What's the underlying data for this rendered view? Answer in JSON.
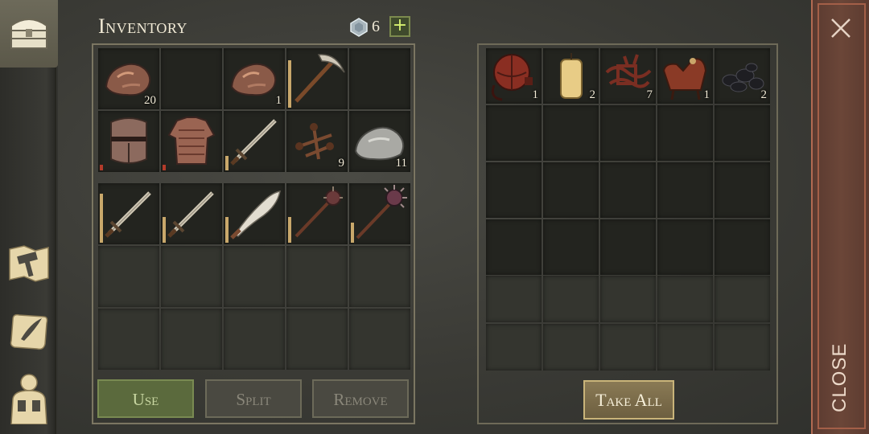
{
  "sidebar": {
    "items": [
      {
        "icon": "chest-icon",
        "active": true
      },
      {
        "icon": "hammer-map-icon"
      },
      {
        "icon": "scroll-quill-icon"
      },
      {
        "icon": "character-backpack-icon"
      }
    ]
  },
  "inventory": {
    "title": "Inventory",
    "gem_count": "6",
    "plus_label": "+",
    "slots": [
      {
        "icon": "copper-ore-icon",
        "count": "20"
      },
      {
        "icon": "empty"
      },
      {
        "icon": "copper-ore-icon",
        "count": "1"
      },
      {
        "icon": "pickaxe-icon",
        "durability": 0.82
      },
      {
        "icon": "empty"
      },
      {
        "icon": "great-helm-icon",
        "durability": 0.1,
        "low": true
      },
      {
        "icon": "chainmail-icon",
        "durability": 0.1,
        "low": true
      },
      {
        "icon": "sword-icon",
        "durability": 0.25
      },
      {
        "icon": "nails-icon",
        "count": "9"
      },
      {
        "icon": "stone-icon",
        "count": "11"
      }
    ],
    "weapon_slots": [
      {
        "icon": "sword-icon",
        "durability": 0.85
      },
      {
        "icon": "sword-icon",
        "durability": 0.45
      },
      {
        "icon": "scimitar-icon",
        "durability": 0.45
      },
      {
        "icon": "mace-icon",
        "durability": 0.45
      },
      {
        "icon": "morningstar-icon",
        "durability": 0.35
      }
    ],
    "buttons": {
      "use": "Use",
      "split": "Split",
      "remove": "Remove"
    }
  },
  "container": {
    "slots": [
      {
        "icon": "leather-flask-icon",
        "count": "1"
      },
      {
        "icon": "candle-icon",
        "count": "2"
      },
      {
        "icon": "leather-straps-icon",
        "count": "7"
      },
      {
        "icon": "saddle-icon",
        "count": "1"
      },
      {
        "icon": "coal-icon",
        "count": "2"
      }
    ],
    "take_all_label": "Take All"
  },
  "close": {
    "label": "CLOSE"
  },
  "colors": {
    "background": "#3a3b36",
    "cell": "#23241f",
    "durability": "#c9a86b",
    "durability_low": "#b33b2a",
    "use_button": "#5b6a3d",
    "close_strip": "#6b4638"
  }
}
